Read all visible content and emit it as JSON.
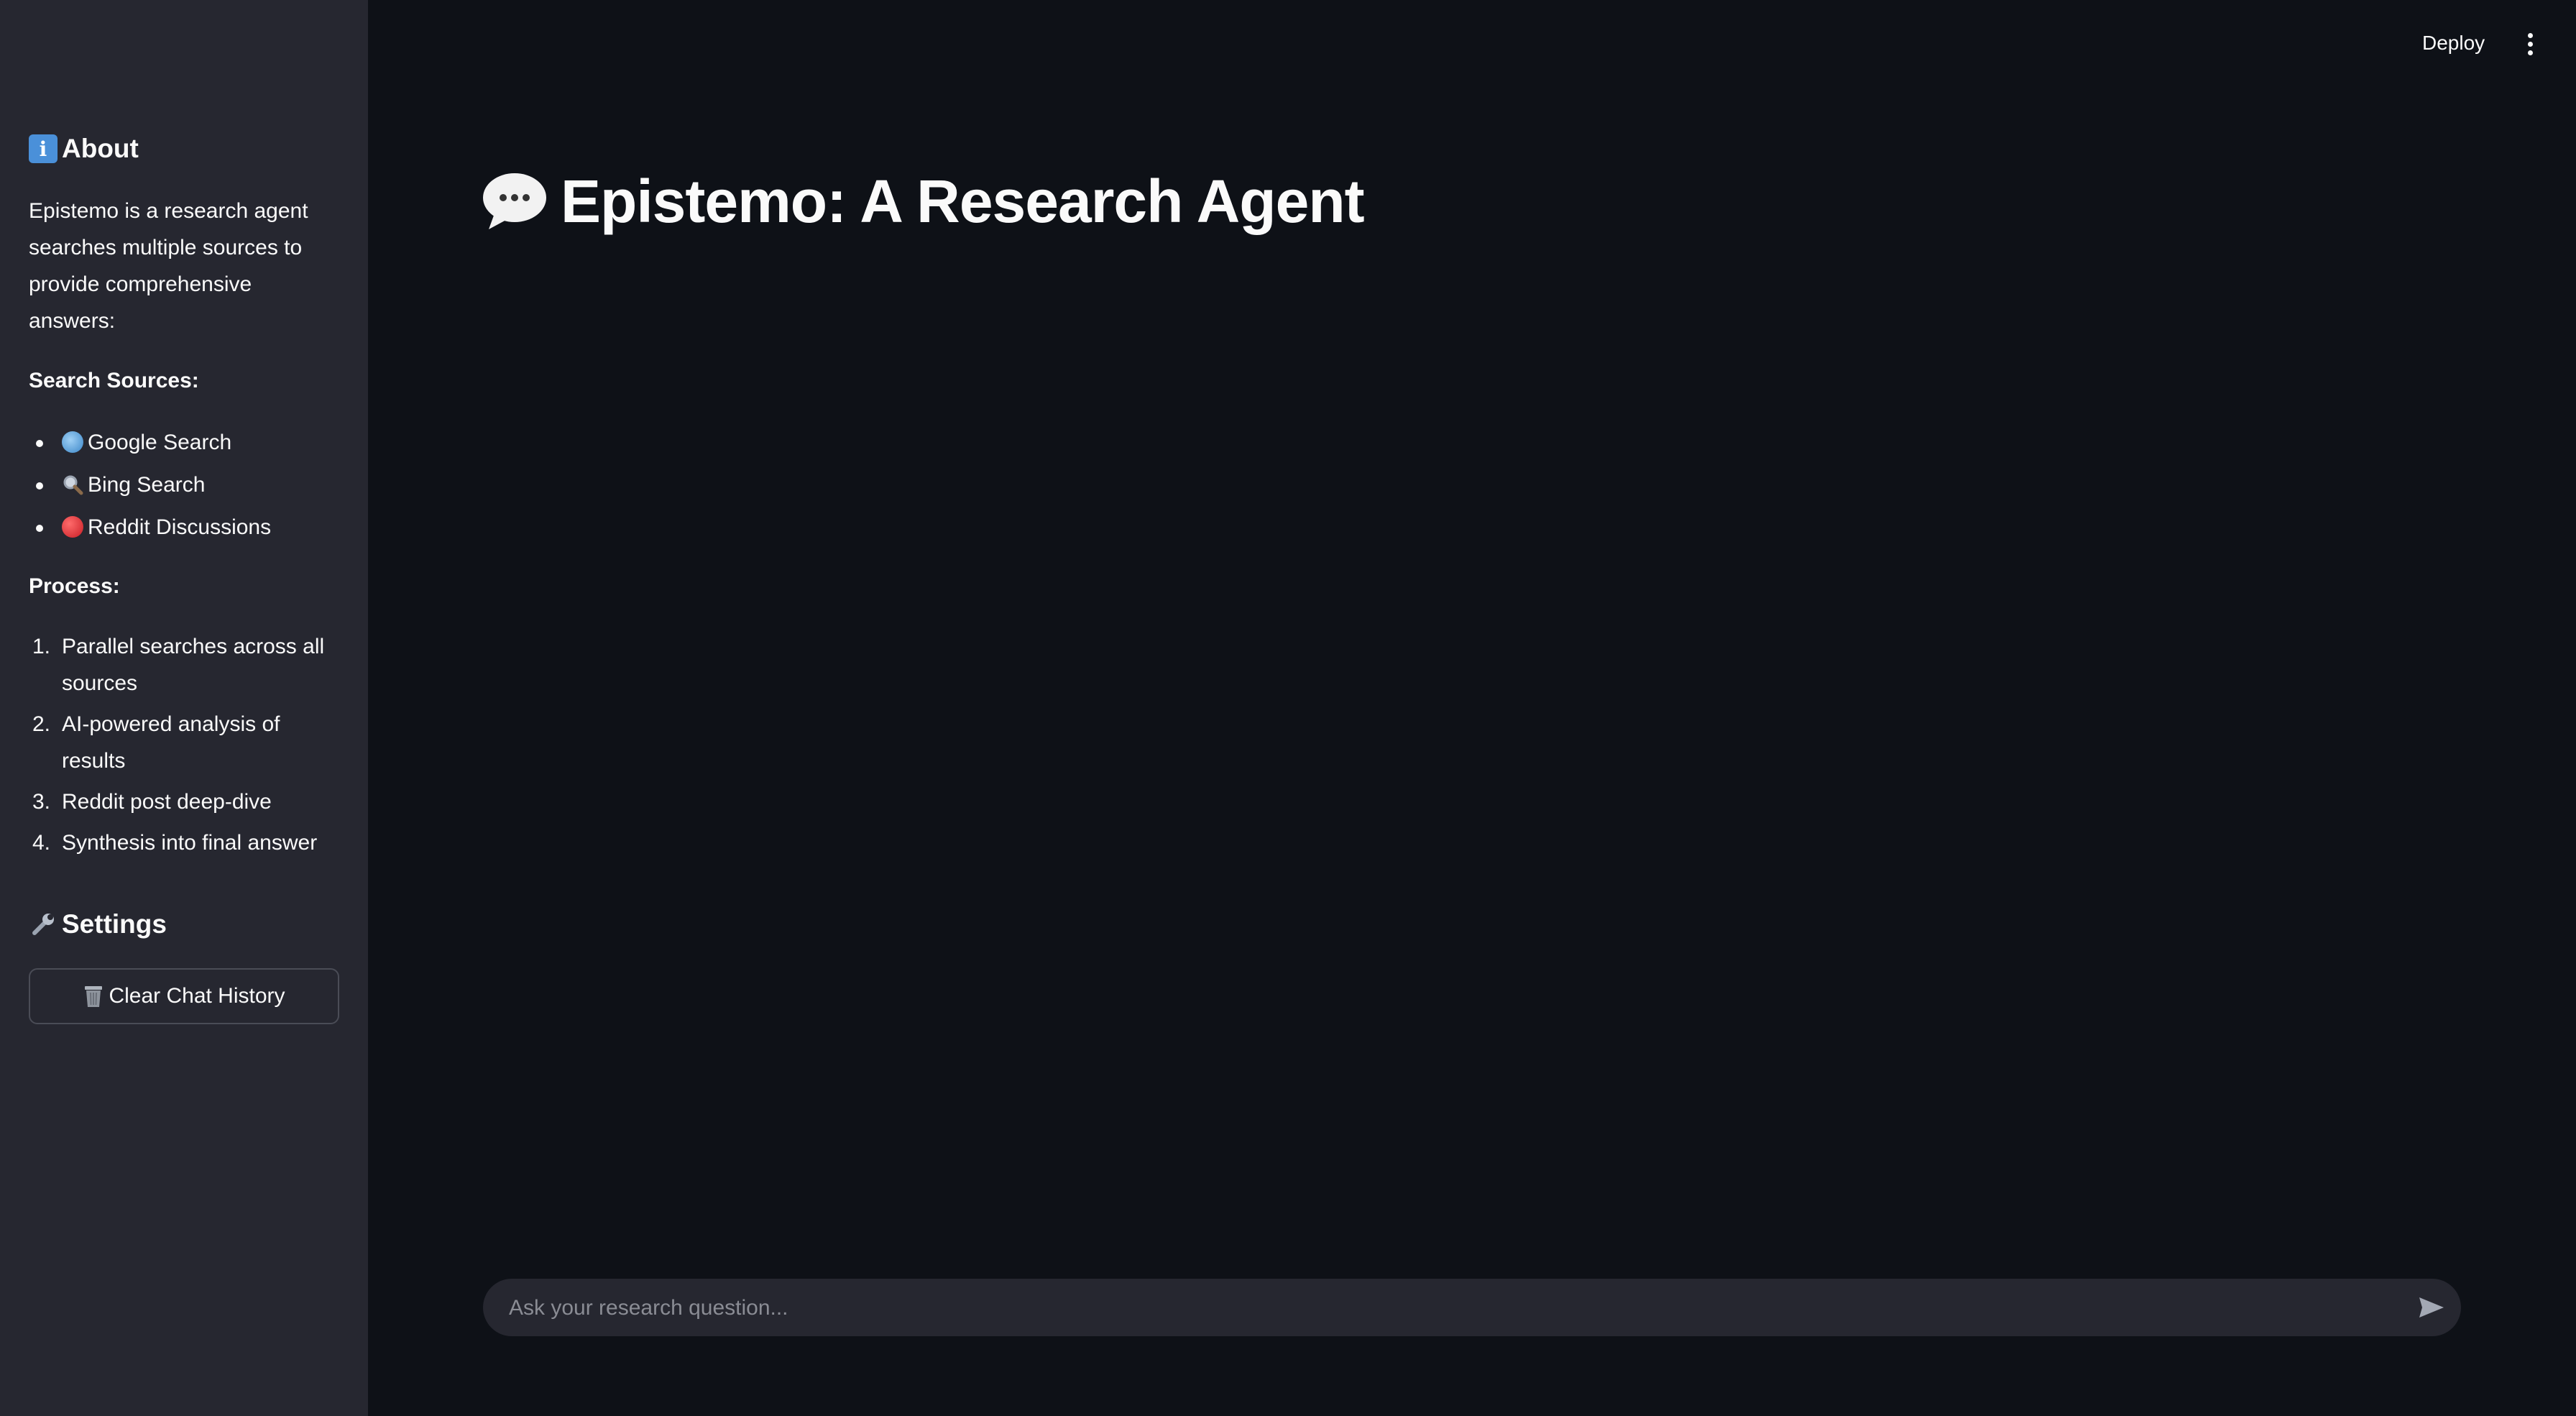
{
  "header": {
    "deploy_label": "Deploy",
    "menu_icon": "more-vert-icon"
  },
  "sidebar": {
    "about": {
      "icon": "info-icon",
      "heading": "About",
      "description": "Epistemo is a research agent searches multiple sources to provide comprehensive answers:",
      "sources_label": "Search Sources:",
      "sources": [
        {
          "icon": "globe-icon",
          "label": "Google Search"
        },
        {
          "icon": "magnifier-icon",
          "label": "Bing Search"
        },
        {
          "icon": "red-circle-icon",
          "label": "Reddit Discussions"
        }
      ],
      "process_label": "Process:",
      "process_steps": [
        {
          "num": "1.",
          "lines": [
            "Parallel searches across all",
            "sources"
          ]
        },
        {
          "num": "2.",
          "lines": [
            "AI-powered analysis of",
            "results"
          ]
        },
        {
          "num": "3.",
          "lines": [
            "Reddit post deep-dive"
          ]
        },
        {
          "num": "4.",
          "lines": [
            "Synthesis into final answer"
          ]
        }
      ]
    },
    "settings": {
      "icon": "wrench-icon",
      "heading": "Settings",
      "clear_button": {
        "icon": "wastebasket-icon",
        "label": "Clear Chat History"
      }
    }
  },
  "main": {
    "title_icon": "speech-balloon-icon",
    "title": "Epistemo: A Research Agent"
  },
  "chat": {
    "placeholder": "Ask your research question...",
    "value": "",
    "send_icon": "send-icon"
  },
  "colors": {
    "background": "#0e1117",
    "sidebar": "#262730",
    "text": "#fafafa",
    "input_bg": "#262730",
    "placeholder": "#8a8c94"
  }
}
